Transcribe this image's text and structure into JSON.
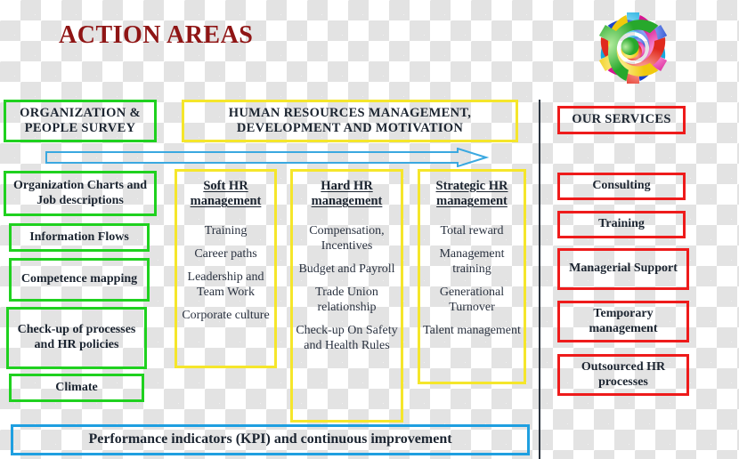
{
  "page": {
    "title": "ACTION AREAS",
    "title_color": "#8f1515"
  },
  "logo": {
    "name": "teamwork-people-circle-logo",
    "colors": [
      "#29b8e5",
      "#35b93a",
      "#f2d51a",
      "#e8342a",
      "#e3229c",
      "#1f4fd8"
    ]
  },
  "headers": {
    "left": "ORGANIZATION & PEOPLE SURVEY",
    "center": "HUMAN RESOURCES MANAGEMENT, DEVELOPMENT AND MOTIVATION",
    "right": "OUR SERVICES"
  },
  "left_column": {
    "accent": "#1fd11f",
    "items": [
      "Organization Charts and Job descriptions",
      "Information Flows",
      "Competence mapping",
      "Check-up of processes and HR policies",
      "Climate"
    ]
  },
  "pillars": {
    "accent": "#f5e62b",
    "columns": [
      {
        "heading": "Soft HR management",
        "items": [
          "Training",
          "Career paths",
          "Leadership and Team Work",
          "Corporate culture"
        ]
      },
      {
        "heading": "Hard HR management",
        "items": [
          "Compensation, Incentives",
          "Budget and Payroll",
          "Trade Union relationship",
          "Check-up On Safety and Health Rules"
        ]
      },
      {
        "heading": "Strategic HR management",
        "items": [
          "Total reward",
          "Management training",
          "Generational Turnover",
          "Talent management"
        ]
      }
    ]
  },
  "right_column": {
    "accent": "#ee1b1b",
    "items": [
      "Consulting",
      "Training",
      "Managerial Support",
      "Temporary management",
      "Outsourced HR processes"
    ]
  },
  "footer": {
    "accent": "#1f9fe0",
    "text": "Performance indicators (KPI) and continuous improvement"
  },
  "arrow": {
    "name": "rightward-flow-arrow",
    "color": "#3aa8e0"
  }
}
